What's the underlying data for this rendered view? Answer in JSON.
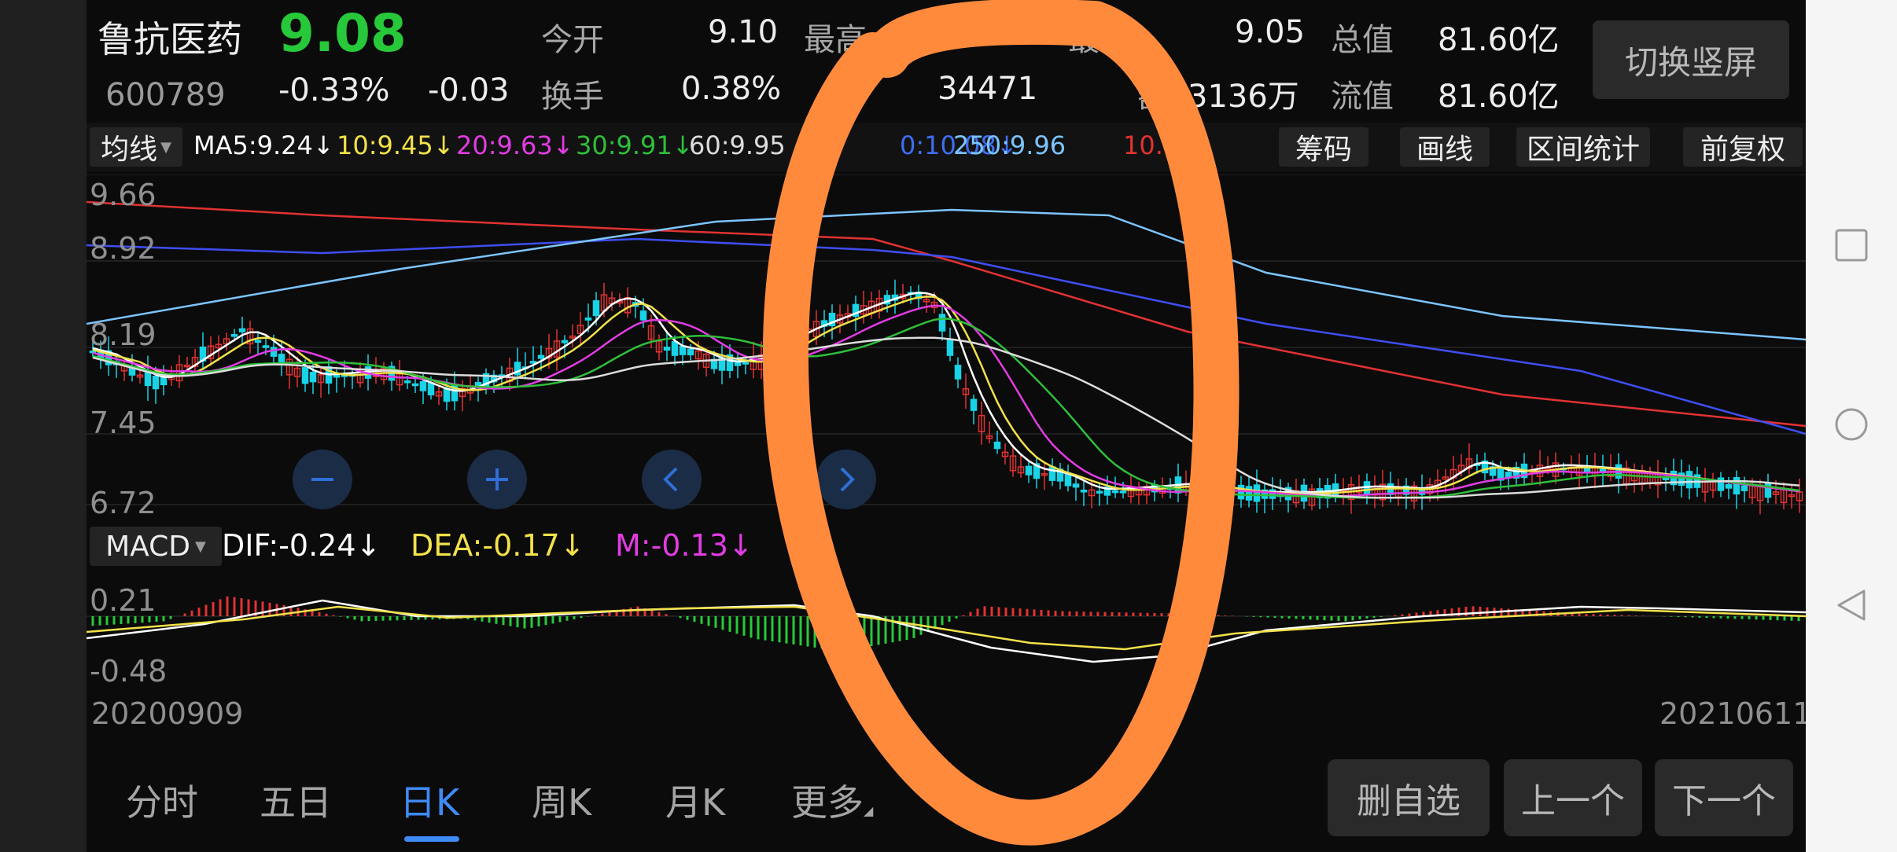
{
  "header": {
    "stock_name": "鲁抗医药",
    "price": "9.08",
    "code": "600789",
    "change_pct": "-0.33%",
    "change_abs": "-0.03",
    "stats": {
      "open_label": "今开",
      "open_value": "9.10",
      "high_label": "最高",
      "low_label": "最低",
      "low_value": "9.05",
      "total_cap_label": "总值",
      "total_cap_value": "81.60亿",
      "turnover_label": "换手",
      "turnover_value": "0.38%",
      "volume_value": "34471",
      "amount_label_partial": "额",
      "amount_value": "3136万",
      "float_cap_label": "流值",
      "float_cap_value": "81.60亿"
    },
    "switch_button": "切换竖屏"
  },
  "ma_bar": {
    "selector": "均线",
    "items": [
      {
        "text": "MA5:9.24↓",
        "color": "#ffffff"
      },
      {
        "text": "10:9.45↓",
        "color": "#f2e14a"
      },
      {
        "text": "20:9.63↓",
        "color": "#e23ce2"
      },
      {
        "text": "30:9.91↓",
        "color": "#2fbf3a"
      },
      {
        "text": "60:9.95",
        "color": "#dcdcdc"
      },
      {
        "text": "0:10.08↓",
        "color": "#3f6ef2"
      },
      {
        "text": "250:9.96",
        "color": "#7cc4ff"
      },
      {
        "text": "10.00↓",
        "color": "#e23232"
      }
    ],
    "buttons": [
      "筹码",
      "画线",
      "区间统计",
      "前复权"
    ]
  },
  "price_axis": [
    "9.66",
    "8.92",
    "8.19",
    "7.45",
    "6.72"
  ],
  "zoom_controls": [
    "minus-icon",
    "plus-icon",
    "chevron-left-icon",
    "chevron-right-icon"
  ],
  "macd_bar": {
    "selector": "MACD",
    "dif": "DIF:-0.24↓",
    "dea": "DEA:-0.17↓",
    "m": "M:-0.13↓"
  },
  "macd_axis": [
    "0.21",
    "-0.48"
  ],
  "date_range": {
    "start": "20200909",
    "end": "20210611"
  },
  "bottom_tabs": [
    "分时",
    "五日",
    "日K",
    "周K",
    "月K",
    "更多"
  ],
  "active_tab": "日K",
  "bottom_buttons": [
    "删自选",
    "上一个",
    "下一个"
  ],
  "colors": {
    "up": "#e23232",
    "down": "#19d3e6",
    "price_green": "#27c93a",
    "accent_blue": "#3f8bf5",
    "annotation_orange": "#ff8a3c"
  }
}
